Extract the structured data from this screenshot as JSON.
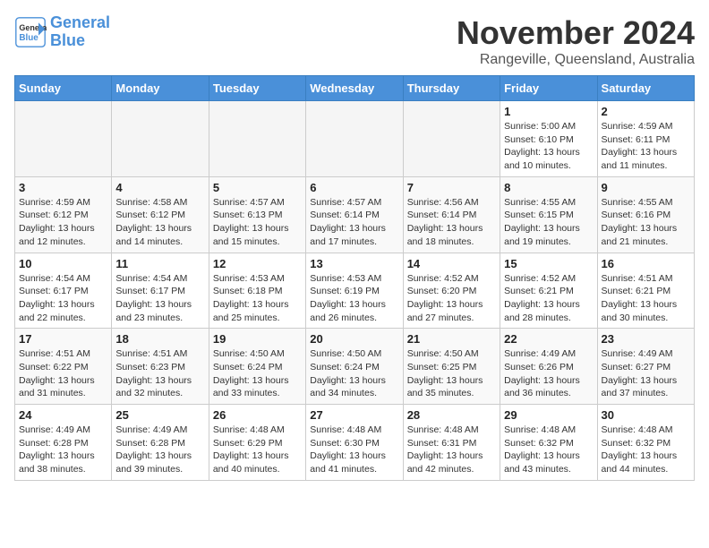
{
  "header": {
    "logo_line1": "General",
    "logo_line2": "Blue",
    "month": "November 2024",
    "location": "Rangeville, Queensland, Australia"
  },
  "weekdays": [
    "Sunday",
    "Monday",
    "Tuesday",
    "Wednesday",
    "Thursday",
    "Friday",
    "Saturday"
  ],
  "weeks": [
    [
      {
        "day": "",
        "info": ""
      },
      {
        "day": "",
        "info": ""
      },
      {
        "day": "",
        "info": ""
      },
      {
        "day": "",
        "info": ""
      },
      {
        "day": "",
        "info": ""
      },
      {
        "day": "1",
        "info": "Sunrise: 5:00 AM\nSunset: 6:10 PM\nDaylight: 13 hours and 10 minutes."
      },
      {
        "day": "2",
        "info": "Sunrise: 4:59 AM\nSunset: 6:11 PM\nDaylight: 13 hours and 11 minutes."
      }
    ],
    [
      {
        "day": "3",
        "info": "Sunrise: 4:59 AM\nSunset: 6:12 PM\nDaylight: 13 hours and 12 minutes."
      },
      {
        "day": "4",
        "info": "Sunrise: 4:58 AM\nSunset: 6:12 PM\nDaylight: 13 hours and 14 minutes."
      },
      {
        "day": "5",
        "info": "Sunrise: 4:57 AM\nSunset: 6:13 PM\nDaylight: 13 hours and 15 minutes."
      },
      {
        "day": "6",
        "info": "Sunrise: 4:57 AM\nSunset: 6:14 PM\nDaylight: 13 hours and 17 minutes."
      },
      {
        "day": "7",
        "info": "Sunrise: 4:56 AM\nSunset: 6:14 PM\nDaylight: 13 hours and 18 minutes."
      },
      {
        "day": "8",
        "info": "Sunrise: 4:55 AM\nSunset: 6:15 PM\nDaylight: 13 hours and 19 minutes."
      },
      {
        "day": "9",
        "info": "Sunrise: 4:55 AM\nSunset: 6:16 PM\nDaylight: 13 hours and 21 minutes."
      }
    ],
    [
      {
        "day": "10",
        "info": "Sunrise: 4:54 AM\nSunset: 6:17 PM\nDaylight: 13 hours and 22 minutes."
      },
      {
        "day": "11",
        "info": "Sunrise: 4:54 AM\nSunset: 6:17 PM\nDaylight: 13 hours and 23 minutes."
      },
      {
        "day": "12",
        "info": "Sunrise: 4:53 AM\nSunset: 6:18 PM\nDaylight: 13 hours and 25 minutes."
      },
      {
        "day": "13",
        "info": "Sunrise: 4:53 AM\nSunset: 6:19 PM\nDaylight: 13 hours and 26 minutes."
      },
      {
        "day": "14",
        "info": "Sunrise: 4:52 AM\nSunset: 6:20 PM\nDaylight: 13 hours and 27 minutes."
      },
      {
        "day": "15",
        "info": "Sunrise: 4:52 AM\nSunset: 6:21 PM\nDaylight: 13 hours and 28 minutes."
      },
      {
        "day": "16",
        "info": "Sunrise: 4:51 AM\nSunset: 6:21 PM\nDaylight: 13 hours and 30 minutes."
      }
    ],
    [
      {
        "day": "17",
        "info": "Sunrise: 4:51 AM\nSunset: 6:22 PM\nDaylight: 13 hours and 31 minutes."
      },
      {
        "day": "18",
        "info": "Sunrise: 4:51 AM\nSunset: 6:23 PM\nDaylight: 13 hours and 32 minutes."
      },
      {
        "day": "19",
        "info": "Sunrise: 4:50 AM\nSunset: 6:24 PM\nDaylight: 13 hours and 33 minutes."
      },
      {
        "day": "20",
        "info": "Sunrise: 4:50 AM\nSunset: 6:24 PM\nDaylight: 13 hours and 34 minutes."
      },
      {
        "day": "21",
        "info": "Sunrise: 4:50 AM\nSunset: 6:25 PM\nDaylight: 13 hours and 35 minutes."
      },
      {
        "day": "22",
        "info": "Sunrise: 4:49 AM\nSunset: 6:26 PM\nDaylight: 13 hours and 36 minutes."
      },
      {
        "day": "23",
        "info": "Sunrise: 4:49 AM\nSunset: 6:27 PM\nDaylight: 13 hours and 37 minutes."
      }
    ],
    [
      {
        "day": "24",
        "info": "Sunrise: 4:49 AM\nSunset: 6:28 PM\nDaylight: 13 hours and 38 minutes."
      },
      {
        "day": "25",
        "info": "Sunrise: 4:49 AM\nSunset: 6:28 PM\nDaylight: 13 hours and 39 minutes."
      },
      {
        "day": "26",
        "info": "Sunrise: 4:48 AM\nSunset: 6:29 PM\nDaylight: 13 hours and 40 minutes."
      },
      {
        "day": "27",
        "info": "Sunrise: 4:48 AM\nSunset: 6:30 PM\nDaylight: 13 hours and 41 minutes."
      },
      {
        "day": "28",
        "info": "Sunrise: 4:48 AM\nSunset: 6:31 PM\nDaylight: 13 hours and 42 minutes."
      },
      {
        "day": "29",
        "info": "Sunrise: 4:48 AM\nSunset: 6:32 PM\nDaylight: 13 hours and 43 minutes."
      },
      {
        "day": "30",
        "info": "Sunrise: 4:48 AM\nSunset: 6:32 PM\nDaylight: 13 hours and 44 minutes."
      }
    ]
  ]
}
